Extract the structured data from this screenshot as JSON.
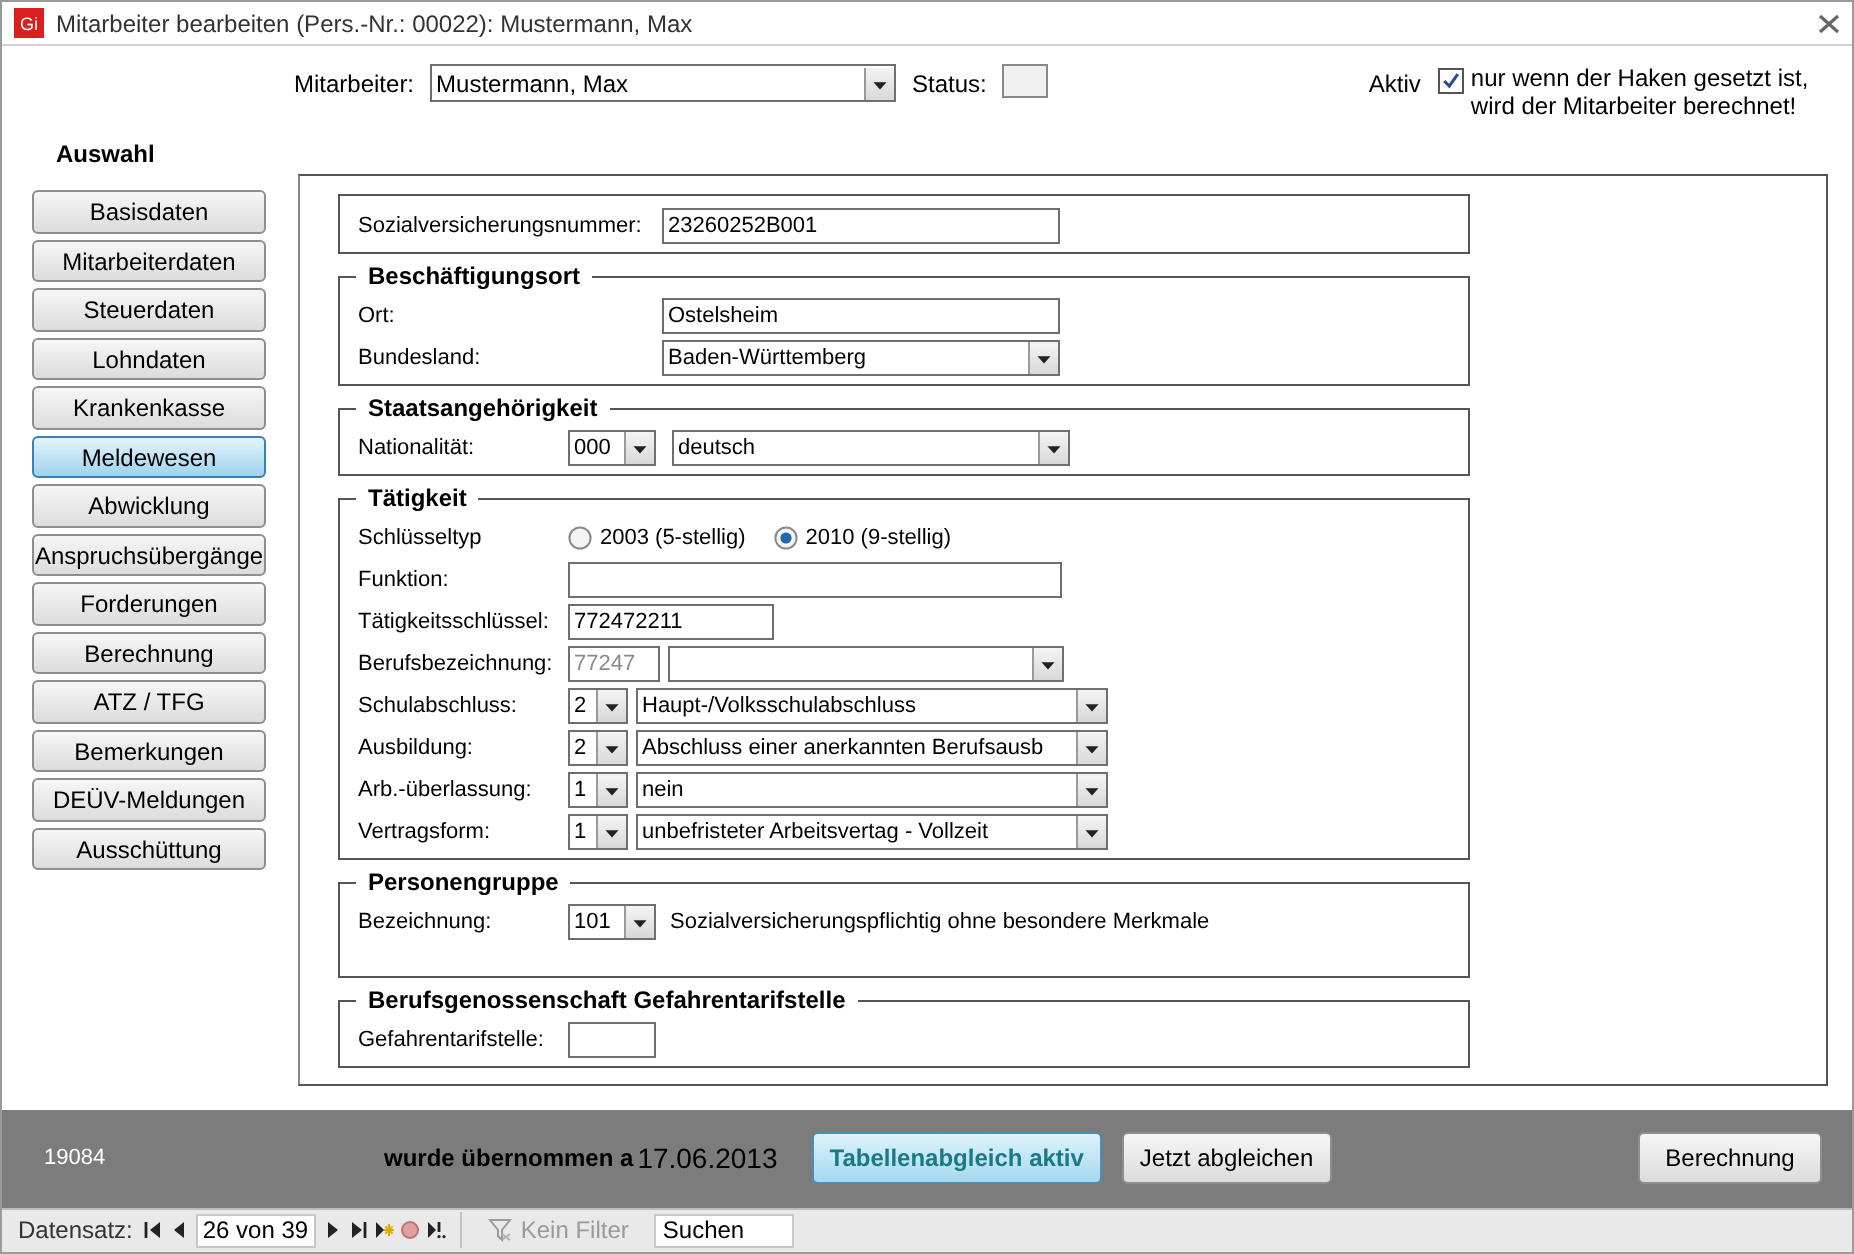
{
  "window": {
    "app_icon": "Gi",
    "title": "Mitarbeiter bearbeiten (Pers.-Nr.: 00022): Mustermann, Max"
  },
  "header": {
    "employee_label": "Mitarbeiter:",
    "employee_value": "Mustermann, Max",
    "status_label": "Status:",
    "active_label": "Aktiv",
    "active_checked": true,
    "active_hint": "nur wenn der Haken gesetzt ist,\nwird der Mitarbeiter berechnet!"
  },
  "sidebar": {
    "title": "Auswahl",
    "items": [
      {
        "label": "Basisdaten",
        "selected": false
      },
      {
        "label": "Mitarbeiterdaten",
        "selected": false
      },
      {
        "label": "Steuerdaten",
        "selected": false
      },
      {
        "label": "Lohndaten",
        "selected": false
      },
      {
        "label": "Krankenkasse",
        "selected": false
      },
      {
        "label": "Meldewesen",
        "selected": true
      },
      {
        "label": "Abwicklung",
        "selected": false
      },
      {
        "label": "Anspruchsübergänge",
        "selected": false
      },
      {
        "label": "Forderungen",
        "selected": false
      },
      {
        "label": "Berechnung",
        "selected": false
      },
      {
        "label": "ATZ / TFG",
        "selected": false
      },
      {
        "label": "Bemerkungen",
        "selected": false
      },
      {
        "label": "DEÜV-Meldungen",
        "selected": false
      },
      {
        "label": "Ausschüttung",
        "selected": false
      }
    ]
  },
  "sections": [
    {
      "rows": [
        {
          "kind": "text",
          "label": "Sozialversicherungsnummer:",
          "value": "23260252B001"
        }
      ]
    },
    {
      "title": "Beschäftigungsort",
      "rows": [
        {
          "kind": "text",
          "label": "Ort:",
          "value": "Ostelsheim"
        },
        {
          "kind": "combo",
          "label": "Bundesland:",
          "value": "Baden-Württemberg"
        }
      ]
    },
    {
      "title": "Staatsangehörigkeit",
      "rows": [
        {
          "kind": "code-combo",
          "label": "Nationalität:",
          "code": "000",
          "value": "deutsch"
        }
      ]
    },
    {
      "title": "Tätigkeit",
      "rows": [
        {
          "kind": "radio",
          "label": "Schlüsseltyp",
          "options": [
            {
              "label": "2003 (5-stellig)",
              "selected": false
            },
            {
              "label": "2010 (9-stellig)",
              "selected": true
            }
          ]
        },
        {
          "kind": "text",
          "label": "Funktion:"
        },
        {
          "kind": "short-text",
          "label": "Tätigkeitsschlüssel:",
          "value": "772472211"
        },
        {
          "kind": "code-field-combo",
          "label": "Berufsbezeichnung:",
          "code": "77247",
          "disabled": true
        },
        {
          "kind": "code-combo",
          "label": "Schulabschluss:",
          "code": "2",
          "value": "Haupt-/Volksschulabschluss"
        },
        {
          "kind": "code-combo",
          "label": "Ausbildung:",
          "code": "2",
          "value": "Abschluss einer anerkannten Berufsausb"
        },
        {
          "kind": "code-combo",
          "label": "Arb.-überlassung:",
          "code": "1",
          "value": "nein"
        },
        {
          "kind": "code-combo",
          "label": "Vertragsform:",
          "code": "1",
          "value": "unbefristeter Arbeitsvertag - Vollzeit"
        }
      ]
    },
    {
      "title": "Personengruppe",
      "rows": [
        {
          "kind": "code-text",
          "label": "Bezeichnung:",
          "code": "101",
          "value": "Sozialversicherungspflichtig ohne besondere Merkmale"
        }
      ]
    },
    {
      "title": "Berufsgenossenschaft Gefahrentarifstelle",
      "rows": [
        {
          "kind": "tiny-text",
          "label": "Gefahrentarifstelle:"
        }
      ]
    }
  ],
  "footer": {
    "record_id": "19084",
    "import_note": "wurde übernommen a",
    "import_date": "17.06.2013",
    "buttons": [
      {
        "label": "Tabellenabgleich aktiv",
        "pressed": true
      },
      {
        "label": "Jetzt abgleichen",
        "pressed": false
      },
      {
        "label": "Berechnung",
        "pressed": false
      }
    ]
  },
  "record_nav": {
    "label": "Datensatz:",
    "position": "26 von 39",
    "filter": {
      "label": "Kein Filter",
      "disabled": true
    },
    "search": {
      "value": "Suchen"
    }
  }
}
